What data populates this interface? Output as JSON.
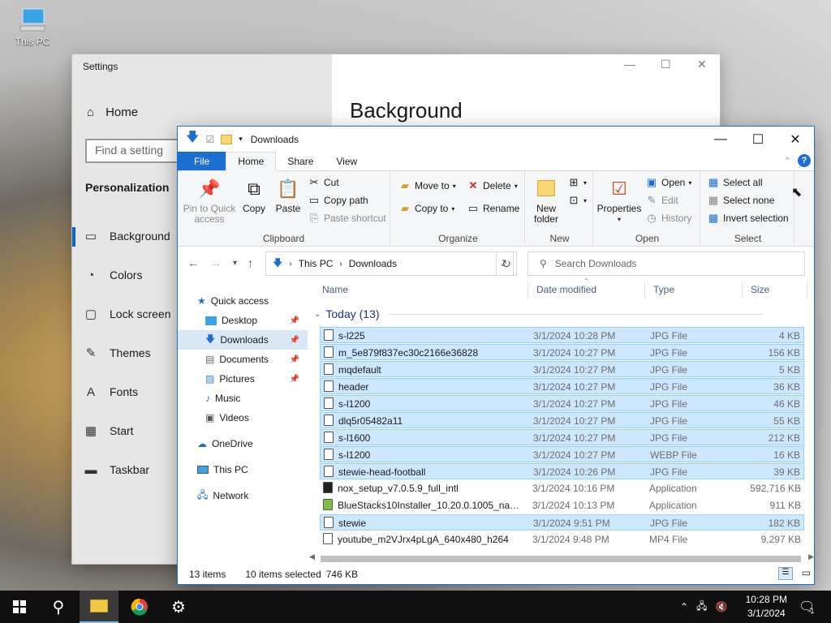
{
  "desktop": {
    "icons": [
      {
        "label": "This PC"
      }
    ]
  },
  "settings": {
    "title": "Settings",
    "home": "Home",
    "search_placeholder": "Find a setting",
    "section": "Personalization",
    "nav": [
      "Background",
      "Colors",
      "Lock screen",
      "Themes",
      "Fonts",
      "Start",
      "Taskbar"
    ],
    "heading": "Background"
  },
  "explorer": {
    "title": "Downloads",
    "tabs": [
      "File",
      "Home",
      "Share",
      "View"
    ],
    "ribbon": {
      "clipboard": {
        "label": "Clipboard",
        "pin": "Pin to Quick access",
        "copy": "Copy",
        "paste": "Paste",
        "cut": "Cut",
        "copy_path": "Copy path",
        "paste_shortcut": "Paste shortcut"
      },
      "organize": {
        "label": "Organize",
        "move_to": "Move to",
        "copy_to": "Copy to",
        "delete": "Delete",
        "rename": "Rename"
      },
      "new": {
        "label": "New",
        "new_folder": "New folder"
      },
      "open": {
        "label": "Open",
        "properties": "Properties",
        "open": "Open",
        "edit": "Edit",
        "history": "History"
      },
      "select": {
        "label": "Select",
        "select_all": "Select all",
        "select_none": "Select none",
        "invert": "Invert selection"
      }
    },
    "address": {
      "crumbs": [
        "This PC",
        "Downloads"
      ]
    },
    "search_placeholder": "Search Downloads",
    "nav_pane": [
      {
        "label": "Quick access",
        "level": 0,
        "pinned": false
      },
      {
        "label": "Desktop",
        "level": 1,
        "pinned": true
      },
      {
        "label": "Downloads",
        "level": 1,
        "pinned": true,
        "selected": true
      },
      {
        "label": "Documents",
        "level": 1,
        "pinned": true
      },
      {
        "label": "Pictures",
        "level": 1,
        "pinned": true
      },
      {
        "label": "Music",
        "level": 1,
        "pinned": false
      },
      {
        "label": "Videos",
        "level": 1,
        "pinned": false
      },
      {
        "label": "OneDrive",
        "level": 0,
        "pinned": false
      },
      {
        "label": "This PC",
        "level": 0,
        "pinned": false
      },
      {
        "label": "Network",
        "level": 0,
        "pinned": false
      }
    ],
    "columns": [
      "Name",
      "Date modified",
      "Type",
      "Size"
    ],
    "group": "Today (13)",
    "files": [
      {
        "name": "s-l225",
        "date": "3/1/2024 10:28 PM",
        "type": "JPG File",
        "size": "4 KB",
        "selected": true
      },
      {
        "name": "m_5e879f837ec30c2166e36828",
        "date": "3/1/2024 10:27 PM",
        "type": "JPG File",
        "size": "156 KB",
        "selected": true
      },
      {
        "name": "mqdefault",
        "date": "3/1/2024 10:27 PM",
        "type": "JPG File",
        "size": "5 KB",
        "selected": true
      },
      {
        "name": "header",
        "date": "3/1/2024 10:27 PM",
        "type": "JPG File",
        "size": "36 KB",
        "selected": true
      },
      {
        "name": "s-l1200",
        "date": "3/1/2024 10:27 PM",
        "type": "JPG File",
        "size": "46 KB",
        "selected": true
      },
      {
        "name": "dlq5r05482a11",
        "date": "3/1/2024 10:27 PM",
        "type": "JPG File",
        "size": "55 KB",
        "selected": true
      },
      {
        "name": "s-l1600",
        "date": "3/1/2024 10:27 PM",
        "type": "JPG File",
        "size": "212 KB",
        "selected": true
      },
      {
        "name": "s-l1200",
        "date": "3/1/2024 10:27 PM",
        "type": "WEBP File",
        "size": "16 KB",
        "selected": true
      },
      {
        "name": "stewie-head-football",
        "date": "3/1/2024 10:26 PM",
        "type": "JPG File",
        "size": "39 KB",
        "selected": true
      },
      {
        "name": "nox_setup_v7.0.5.9_full_intl",
        "date": "3/1/2024 10:16 PM",
        "type": "Application",
        "size": "592,716 KB",
        "selected": false
      },
      {
        "name": "BlueStacks10Installer_10.20.0.1005_native...",
        "date": "3/1/2024 10:13 PM",
        "type": "Application",
        "size": "911 KB",
        "selected": false
      },
      {
        "name": "stewie",
        "date": "3/1/2024 9:51 PM",
        "type": "JPG File",
        "size": "182 KB",
        "selected": true
      },
      {
        "name": "youtube_m2VJrx4pLgA_640x480_h264",
        "date": "3/1/2024 9:48 PM",
        "type": "MP4 File",
        "size": "9,297 KB",
        "selected": false
      }
    ],
    "status": {
      "items": "13 items",
      "selected": "10 items selected",
      "size": "746 KB"
    }
  },
  "taskbar": {
    "time": "10:28 PM",
    "date": "3/1/2024",
    "notifications": "1"
  },
  "colors": {
    "accent": "#1a6fd1",
    "selection": "#cce8ff"
  }
}
